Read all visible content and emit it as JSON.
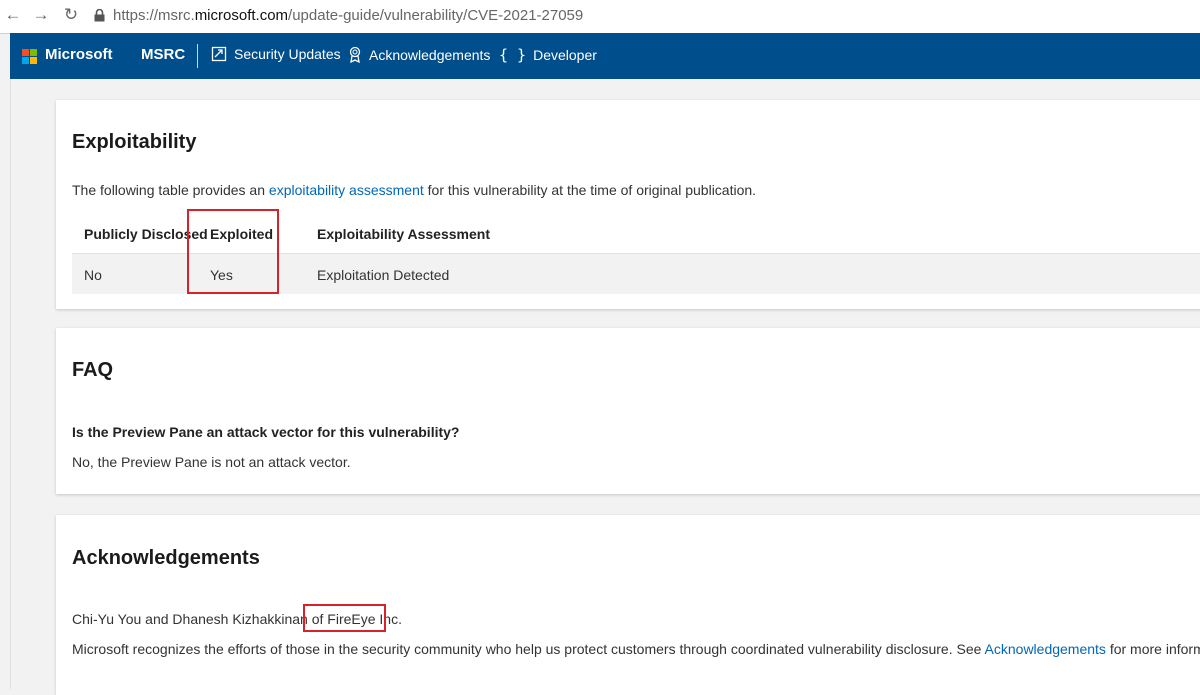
{
  "browser": {
    "url_prefix": "https://msrc.",
    "url_host": "microsoft.com",
    "url_path": "/update-guide/vulnerability/CVE-2021-27059",
    "back_icon": "back-arrow-icon",
    "forward_icon": "forward-arrow-icon",
    "reload_icon": "reload-icon",
    "lock_icon": "lock-icon"
  },
  "header": {
    "brand": "Microsoft",
    "site": "MSRC",
    "logo_colors": [
      "#f25022",
      "#7fba00",
      "#00a4ef",
      "#ffb900"
    ],
    "bg_color": "#004e8c",
    "nav": [
      {
        "label": "Security Updates",
        "icon": "security-updates-icon"
      },
      {
        "label": "Acknowledgements",
        "icon": "award-icon"
      },
      {
        "label": "Developer",
        "icon": "braces-icon"
      }
    ]
  },
  "exploitability": {
    "title": "Exploitability",
    "intro_before": "The following table provides an ",
    "intro_link": "exploitability assessment",
    "intro_after": " for this vulnerability at the time of original publication.",
    "columns": [
      "Publicly Disclosed",
      "Exploited",
      "Exploitability Assessment"
    ],
    "row": [
      "No",
      "Yes",
      "Exploitation Detected"
    ]
  },
  "faq": {
    "title": "FAQ",
    "question": "Is the Preview Pane an attack vector for this vulnerability?",
    "answer": "No, the Preview Pane is not an attack vector."
  },
  "acknowledgements": {
    "title": "Acknowledgements",
    "credit_before": "Chi-Yu You and Dhanesh Kizhakkinan of ",
    "credit_org": "FireEye Inc.",
    "recognition_before": "Microsoft recognizes the efforts of those in the security community who help us protect customers through coordinated vulnerability disclosure. See ",
    "recognition_link": "Acknowledgements",
    "recognition_after": " for more information."
  },
  "accent_colors": {
    "link": "#0067b8",
    "highlight_box": "#d6222a"
  }
}
